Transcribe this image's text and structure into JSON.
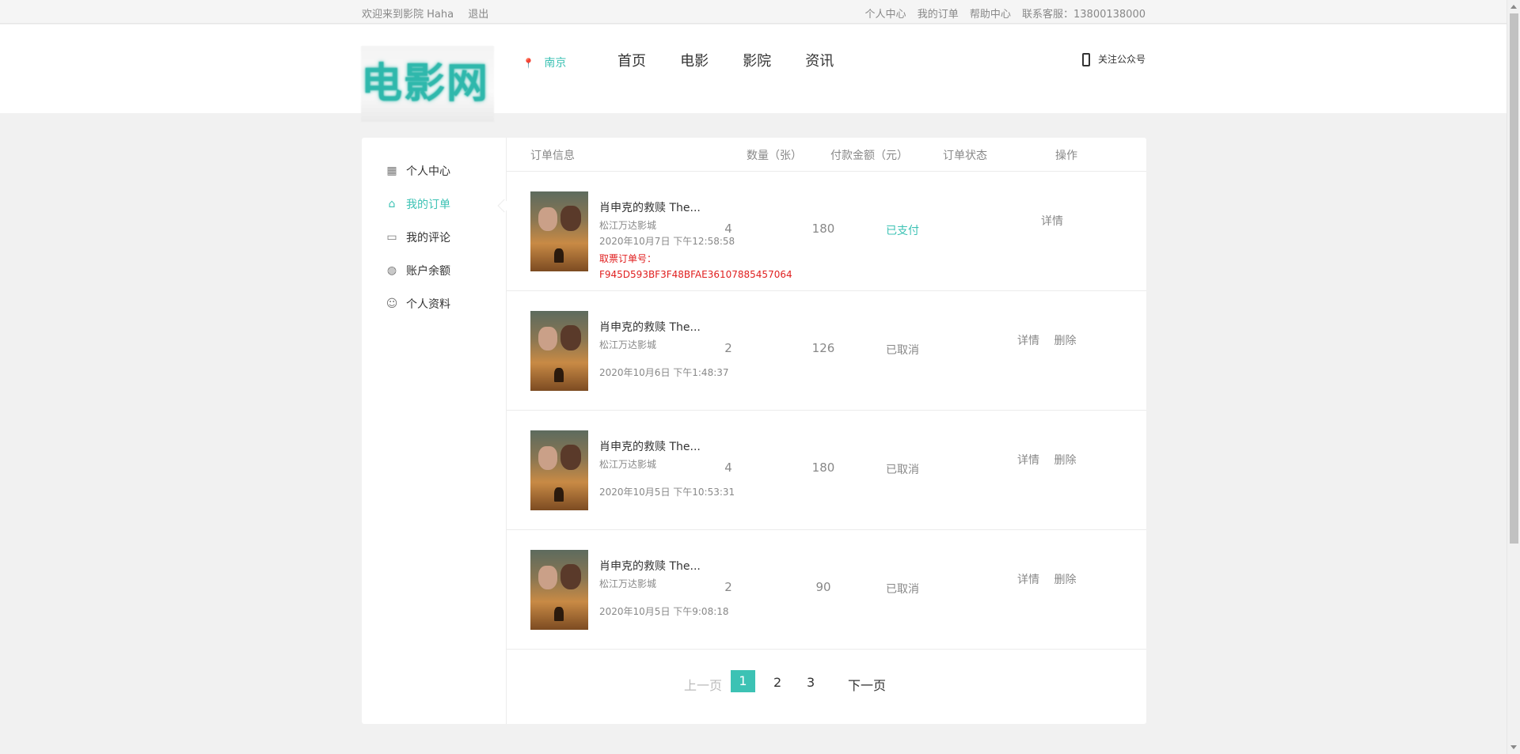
{
  "topbar": {
    "welcome": "欢迎来到影院 Haha",
    "logout": "退出",
    "personal_center": "个人中心",
    "my_orders": "我的订单",
    "help_center": "帮助中心",
    "service": "联系客服：13800138000"
  },
  "header": {
    "logo": "电影网",
    "city": "南京",
    "nav": [
      "首页",
      "电影",
      "影院",
      "资讯"
    ],
    "follow": "关注公众号"
  },
  "sidebar": {
    "items": [
      {
        "label": "个人中心",
        "icon": "grid-icon"
      },
      {
        "label": "我的订单",
        "icon": "bag-icon"
      },
      {
        "label": "我的评论",
        "icon": "comment-icon"
      },
      {
        "label": "账户余额",
        "icon": "wallet-icon"
      },
      {
        "label": "个人资料",
        "icon": "user-icon"
      }
    ],
    "active_index": 1,
    "accent": "#3cc2b4"
  },
  "table": {
    "headers": [
      "订单信息",
      "数量（张）",
      "付款金额（元）",
      "订单状态",
      "操作"
    ],
    "rows": [
      {
        "title": "肖申克的救赎 The...",
        "cinema": "松江万达影城",
        "time": "2020年10月7日 下午12:58:58",
        "code_label": "取票订单号：",
        "code": "F945D593BF3F48BFAE36107885457064",
        "qty": "4",
        "amount": "180",
        "status": "已支付",
        "ops": [
          "详情"
        ]
      },
      {
        "title": "肖申克的救赎 The...",
        "cinema": "松江万达影城",
        "time": "2020年10月6日 下午1:48:37",
        "qty": "2",
        "amount": "126",
        "status": "已取消",
        "ops": [
          "详情",
          "删除"
        ]
      },
      {
        "title": "肖申克的救赎 The...",
        "cinema": "松江万达影城",
        "time": "2020年10月5日 下午10:53:31",
        "qty": "4",
        "amount": "180",
        "status": "已取消",
        "ops": [
          "详情",
          "删除"
        ]
      },
      {
        "title": "肖申克的救赎 The...",
        "cinema": "松江万达影城",
        "time": "2020年10月5日 下午9:08:18",
        "qty": "2",
        "amount": "90",
        "status": "已取消",
        "ops": [
          "详情",
          "删除"
        ]
      }
    ]
  },
  "pagination": {
    "prev": "上一页",
    "pages": [
      "1",
      "2",
      "3"
    ],
    "current": "1",
    "next": "下一页"
  }
}
